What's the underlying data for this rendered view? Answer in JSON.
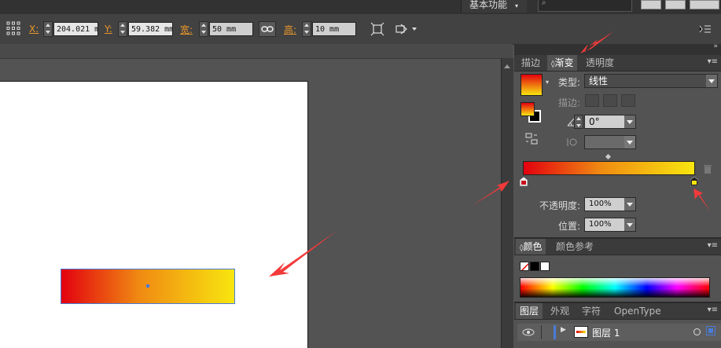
{
  "workspace": {
    "label": "基本功能"
  },
  "control_bar": {
    "x_label": "X:",
    "x_value": "204.021 mm",
    "y_label": "Y:",
    "y_value": "59.382 mm",
    "w_label": "宽:",
    "w_value": "50 mm",
    "h_label": "高:",
    "h_value": "10 mm"
  },
  "panel_top": {
    "tabs": [
      "描边",
      "渐变",
      "透明度"
    ],
    "active_tab": "渐变",
    "type_label": "类型:",
    "type_value": "线性",
    "stroke_label": "描边:",
    "angle_value": "0°",
    "aspect_value": "",
    "opacity_label": "不透明度:",
    "opacity_value": "100%",
    "location_label": "位置:",
    "location_value": "100%"
  },
  "panel_color": {
    "tabs": [
      "颜色",
      "颜色参考"
    ],
    "active_tab": "颜色"
  },
  "panel_layers": {
    "tabs": [
      "图层",
      "外观",
      "字符",
      "OpenType"
    ],
    "active_tab": "图层",
    "layer_name": "图层 1"
  },
  "colors": {
    "gradient_start": "#e3000f",
    "gradient_end": "#f8e60f",
    "selection_blue": "#4a7bd8",
    "annotation_red": "#f23a3a"
  }
}
